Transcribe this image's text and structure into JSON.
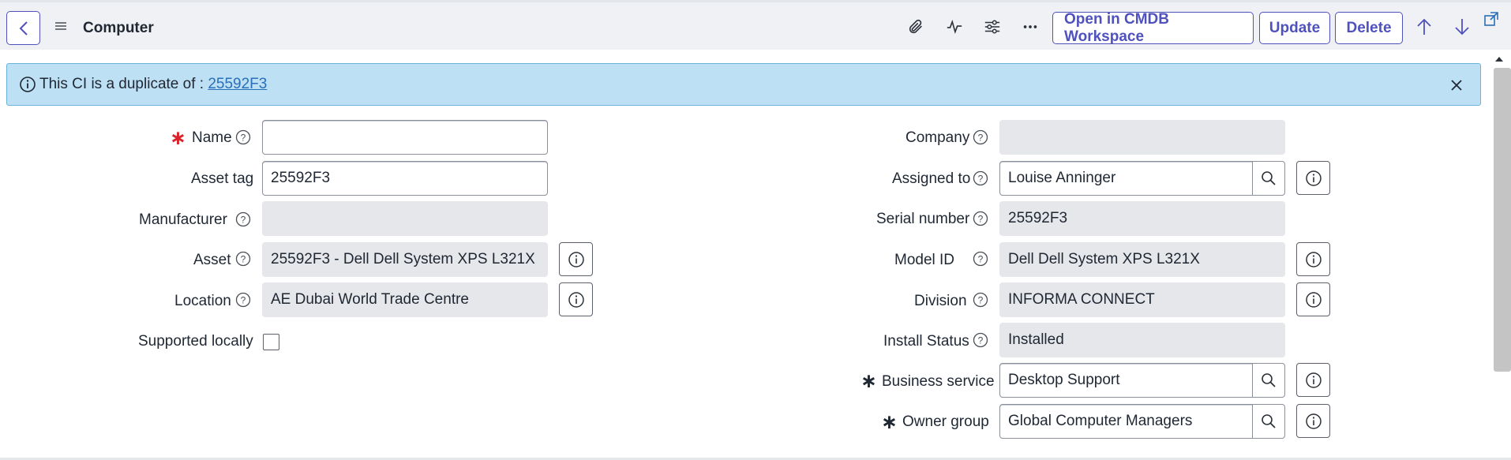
{
  "header": {
    "title": "Computer",
    "buttons": {
      "open_workspace": "Open in CMDB Workspace",
      "update": "Update",
      "delete": "Delete"
    },
    "icons": [
      "back-icon",
      "menu-icon",
      "attachment-icon",
      "activity-icon",
      "settings-icon",
      "more-icon",
      "arrow-up-icon",
      "arrow-down-icon",
      "popout-icon"
    ]
  },
  "banner": {
    "text": "This CI is a duplicate of : ",
    "link": "25592F3"
  },
  "form_left": {
    "name": {
      "label": "Name",
      "value": ""
    },
    "asset_tag": {
      "label": "Asset tag",
      "value": "25592F3"
    },
    "manufacturer": {
      "label": "Manufacturer",
      "value": ""
    },
    "asset": {
      "label": "Asset",
      "value": "25592F3 - Dell Dell System XPS L321X"
    },
    "location": {
      "label": "Location",
      "value": "AE Dubai World Trade Centre"
    },
    "supported_locally": {
      "label": "Supported locally",
      "checked": false
    }
  },
  "form_right": {
    "company": {
      "label": "Company",
      "value": ""
    },
    "assigned_to": {
      "label": "Assigned to",
      "value": "Louise Anninger"
    },
    "serial_number": {
      "label": "Serial number",
      "value": "25592F3"
    },
    "model_id": {
      "label": "Model ID",
      "value": "Dell Dell System XPS L321X"
    },
    "division": {
      "label": "Division",
      "value": "INFORMA CONNECT"
    },
    "install_status": {
      "label": "Install Status",
      "value": "Installed"
    },
    "business_service": {
      "label": "Business service",
      "value": "Desktop Support"
    },
    "owner_group": {
      "label": "Owner group",
      "value": "Global Computer Managers"
    }
  },
  "colors": {
    "accent": "#4f52bd",
    "required_red": "#d9222a",
    "banner_bg": "#bde0f4",
    "readonly_bg": "#e6e7ea"
  }
}
